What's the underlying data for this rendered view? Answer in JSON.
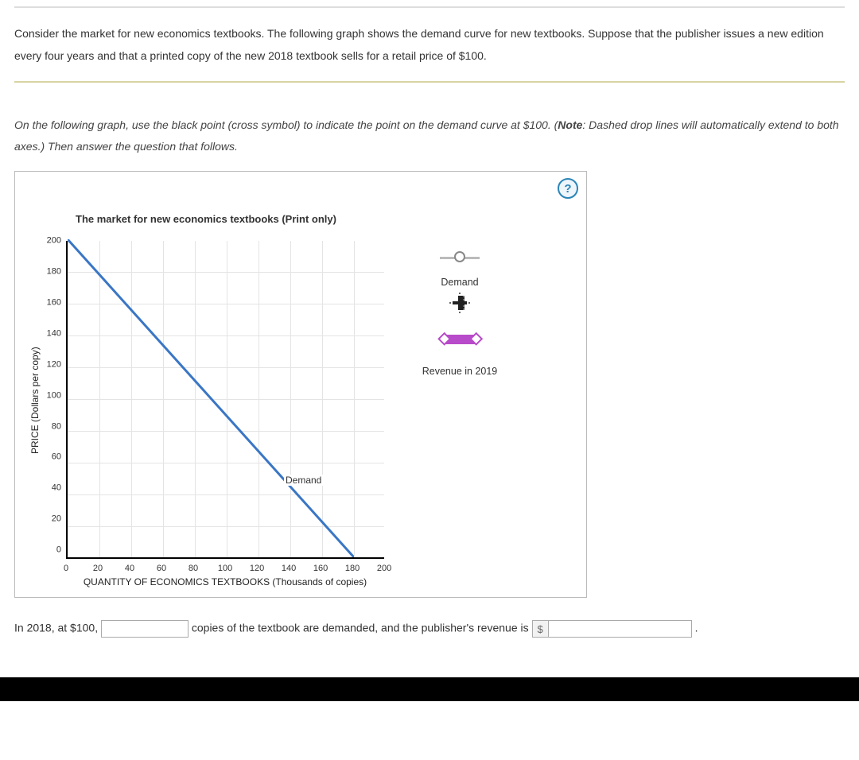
{
  "question": {
    "text": "Consider the market for new economics textbooks. The following graph shows the demand curve for new textbooks. Suppose that the publisher issues a new edition every four years and that a printed copy of the new 2018 textbook sells for a retail price of $100."
  },
  "instruction": {
    "prefix": "On the following graph, use the black point (cross symbol) to indicate the point on the demand curve at $100. (",
    "note_label": "Note",
    "note_text": ": Dashed drop lines will automatically extend to both axes.) Then answer the question that follows."
  },
  "help_symbol": "?",
  "chart_data": {
    "type": "line",
    "title": "The market for new economics textbooks (Print only)",
    "xlabel": "QUANTITY OF ECONOMICS TEXTBOOKS (Thousands of copies)",
    "ylabel": "PRICE (Dollars per copy)",
    "xlim": [
      0,
      200
    ],
    "ylim": [
      0,
      200
    ],
    "x_ticks": [
      "0",
      "20",
      "40",
      "60",
      "80",
      "100",
      "120",
      "140",
      "160",
      "180",
      "200"
    ],
    "y_ticks": [
      "200",
      "180",
      "160",
      "140",
      "120",
      "100",
      "80",
      "60",
      "40",
      "20",
      "0"
    ],
    "series": [
      {
        "name": "Demand",
        "x": [
          0,
          180
        ],
        "y": [
          200,
          0
        ],
        "color": "#3a76c5"
      }
    ],
    "series_label": "Demand"
  },
  "legend": {
    "demand_tool": "Demand",
    "revenue_tool": "Revenue in 2019"
  },
  "answer": {
    "prefix": "In 2018, at $100,",
    "mid": "copies of the textbook are demanded, and the publisher's revenue is",
    "dollar": "$",
    "suffix": "."
  }
}
